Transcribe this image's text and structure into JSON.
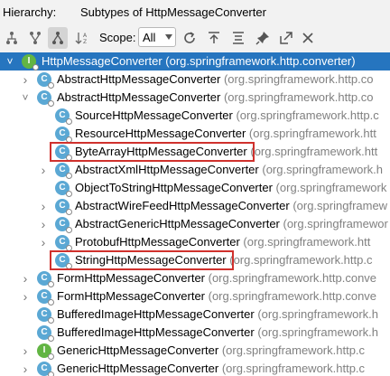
{
  "header": {
    "label": "Hierarchy:",
    "text": "Subtypes of HttpMessageConverter"
  },
  "toolbar": {
    "scope_label": "Scope:",
    "scope_value": "All",
    "icons": [
      "class-hierarchy-icon",
      "supertypes-icon",
      "subtypes-icon",
      "sort-alpha-icon",
      "refresh-icon",
      "export-icon",
      "collapse-all-icon",
      "pin-icon",
      "open-icon",
      "close-icon"
    ]
  },
  "tree": [
    {
      "name": "HttpMessageConverter",
      "pkg": "(org.springframework.http.converter)",
      "depth": 0,
      "icon": "I",
      "expanded": true,
      "selected": true
    },
    {
      "name": "AbstractHttpMessageConverter",
      "pkg": "(org.springframework.http.co",
      "depth": 1,
      "icon": "C",
      "expanded": false,
      "arrow": "right"
    },
    {
      "name": "AbstractHttpMessageConverter",
      "pkg": "(org.springframework.http.co",
      "depth": 1,
      "icon": "C",
      "expanded": true,
      "arrow": "down"
    },
    {
      "name": "SourceHttpMessageConverter",
      "pkg": "(org.springframework.http.c",
      "depth": 2,
      "icon": "C"
    },
    {
      "name": "ResourceHttpMessageConverter",
      "pkg": "(org.springframework.htt",
      "depth": 2,
      "icon": "C"
    },
    {
      "name": "ByteArrayHttpMessageConverter",
      "pkg": "(org.springframework.htt",
      "depth": 2,
      "icon": "C",
      "highlight": true
    },
    {
      "name": "AbstractXmlHttpMessageConverter",
      "pkg": "(org.springframework.h",
      "depth": 2,
      "icon": "C",
      "arrow": "right"
    },
    {
      "name": "ObjectToStringHttpMessageConverter",
      "pkg": "(org.springframework",
      "depth": 2,
      "icon": "C"
    },
    {
      "name": "AbstractWireFeedHttpMessageConverter",
      "pkg": "(org.springframew",
      "depth": 2,
      "icon": "C",
      "arrow": "right"
    },
    {
      "name": "AbstractGenericHttpMessageConverter",
      "pkg": "(org.springframewor",
      "depth": 2,
      "icon": "C",
      "arrow": "right"
    },
    {
      "name": "ProtobufHttpMessageConverter",
      "pkg": "(org.springframework.htt",
      "depth": 2,
      "icon": "C",
      "arrow": "right"
    },
    {
      "name": "StringHttpMessageConverter",
      "pkg": "(org.springframework.http.c",
      "depth": 2,
      "icon": "C",
      "highlight": true
    },
    {
      "name": "FormHttpMessageConverter",
      "pkg": "(org.springframework.http.conve",
      "depth": 1,
      "icon": "C",
      "arrow": "right"
    },
    {
      "name": "FormHttpMessageConverter",
      "pkg": "(org.springframework.http.conve",
      "depth": 1,
      "icon": "C",
      "arrow": "right"
    },
    {
      "name": "BufferedImageHttpMessageConverter",
      "pkg": "(org.springframework.h",
      "depth": 1,
      "icon": "C"
    },
    {
      "name": "BufferedImageHttpMessageConverter",
      "pkg": "(org.springframework.h",
      "depth": 1,
      "icon": "C"
    },
    {
      "name": "GenericHttpMessageConverter",
      "pkg": "(org.springframework.http.c",
      "depth": 1,
      "icon": "I",
      "arrow": "right"
    },
    {
      "name": "GenericHttpMessageConverter",
      "pkg": "(org.springframework.http.c",
      "depth": 1,
      "icon": "C",
      "arrow": "right"
    }
  ]
}
